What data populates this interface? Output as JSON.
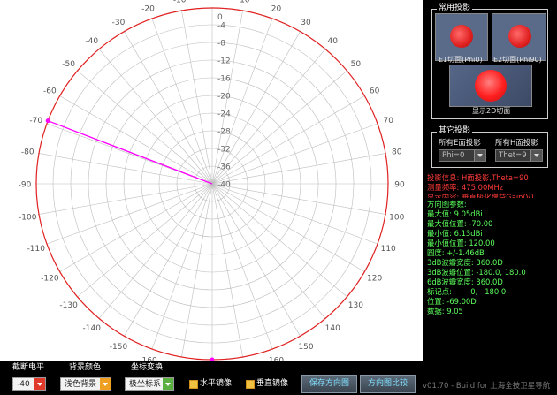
{
  "plot": {
    "angle_labels": [
      "0",
      "10",
      "20",
      "30",
      "40",
      "50",
      "60",
      "70",
      "80",
      "90",
      "100",
      "110",
      "120",
      "130",
      "140",
      "150",
      "160",
      "170",
      "180",
      "-170",
      "-160",
      "-150",
      "-140",
      "-130",
      "-120",
      "-110",
      "-100",
      "-90",
      "-80",
      "-70",
      "-60",
      "-50",
      "-40",
      "-30",
      "-20",
      "-10"
    ],
    "radial_labels": [
      "0",
      "-4",
      "-8",
      "-12",
      "-16",
      "-20",
      "-24",
      "-28",
      "-32",
      "-36",
      "-40"
    ],
    "colors": {
      "circle": "#e02020",
      "grid": "#bdbdbd",
      "cursor": "#ff00ff"
    },
    "cursor_angle_deg": -69,
    "peak_angle_deg": 180
  },
  "common_projection": {
    "title": "常用投影",
    "e1_label": "E1切面(Phi0)",
    "e2_label": "E2切面(Phi90)",
    "show2d_label": "显示2D切面"
  },
  "other_projection": {
    "title": "其它投影",
    "e_label": "所有E面投影",
    "h_label": "所有H面投影",
    "e_value": "Phi=0",
    "h_value": "Thet=9"
  },
  "info_lines": [
    {
      "text": "投影信息: H面投影,Theta=90",
      "color": "red"
    },
    {
      "text": "测量频率: 475.00MHz",
      "color": "red"
    },
    {
      "text": "显示内容: 垂直极化增益Gain(V)",
      "color": "red"
    },
    {
      "text": "方向图参数:",
      "color": "green"
    },
    {
      "text": "最大值: 9.05dBi",
      "color": "green"
    },
    {
      "text": "最大值位置: -70.00",
      "color": "green"
    },
    {
      "text": "最小值: 6.13dBi",
      "color": "green"
    },
    {
      "text": "最小值位置: 120.00",
      "color": "green"
    },
    {
      "text": "圆度: +/-1.46dB",
      "color": "green"
    },
    {
      "text": "3dB波瓣宽度: 360.0D",
      "color": "green"
    },
    {
      "text": "3dB波瓣位置: -180.0, 180.0",
      "color": "green"
    },
    {
      "text": "6dB波瓣宽度: 360.0D",
      "color": "green"
    },
    {
      "text": "标记点:        0,   180.0",
      "color": "green"
    },
    {
      "text": "位置: -69.00D",
      "color": "green"
    },
    {
      "text": "数据: 9.05",
      "color": "green"
    }
  ],
  "bottom": {
    "cutoff_label": "截断电平",
    "cutoff_value": "-40",
    "bg_label": "背景颜色",
    "bg_value": "浅色背景",
    "coord_label": "坐标变换",
    "coord_value": "极坐标系",
    "h_mirror": "水平镜像",
    "v_mirror": "垂直镜像",
    "save_button": "保存方向图",
    "compare_button": "方向图比较",
    "version": "v01.70 - Build for 上海全技卫星导航"
  }
}
